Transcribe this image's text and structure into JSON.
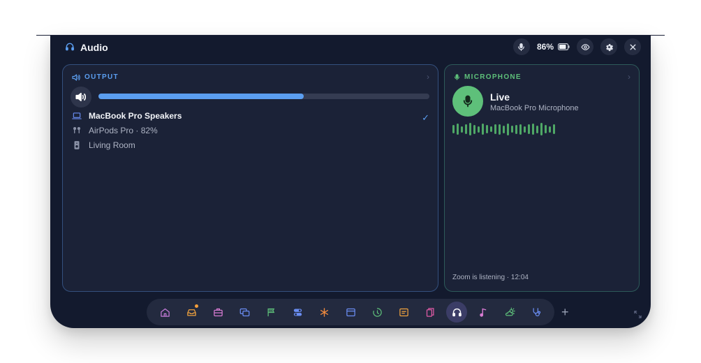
{
  "window": {
    "title": "Audio",
    "title_icon": "headphones-icon"
  },
  "topbar": {
    "battery_percent": "86%",
    "battery_level": 0.86
  },
  "output": {
    "header": "OUTPUT",
    "volume_level": 0.62,
    "devices": [
      {
        "name": "MacBook Pro Speakers",
        "icon": "laptop-icon",
        "selected": true
      },
      {
        "name": "AirPods Pro · 82%",
        "icon": "airpods-icon",
        "selected": false
      },
      {
        "name": "Living Room",
        "icon": "speaker-icon",
        "selected": false
      }
    ],
    "check": "✓"
  },
  "microphone": {
    "header": "MICROPHONE",
    "status": "Live",
    "device": "MacBook Pro Microphone",
    "footer": "Zoom is listening · 12:04"
  },
  "dock": {
    "items": [
      "home-icon",
      "inbox-icon",
      "briefcase-icon",
      "windows-icon",
      "flag-icon",
      "toggles-icon",
      "asterisk-icon",
      "calendar-window-icon",
      "timer-icon",
      "notes-icon",
      "files-icon",
      "headphones-icon",
      "music-note-icon",
      "weather-icon",
      "stethoscope-icon"
    ],
    "active": "headphones-icon",
    "plus_label": "+",
    "colors": {
      "home": "#c47bd8",
      "inbox": "#f0a23e",
      "briefcase": "#d77bd2",
      "windows": "#6a8df3",
      "flag": "#5ec07a",
      "toggles": "#6a8df3",
      "asterisk": "#f08a3e",
      "calendar": "#6a8df3",
      "timer": "#5ec07a",
      "notes": "#f0a23e",
      "files": "#e05ba5",
      "headphones": "#ffffff",
      "music": "#d77bd2",
      "weather": "#5ec07a",
      "stethoscope": "#6a8df3"
    }
  },
  "colors": {
    "accent_blue": "#5b9ef0",
    "accent_green": "#5ec07a",
    "panel_bg": "#1b2237",
    "window_bg": "#131a2e"
  }
}
